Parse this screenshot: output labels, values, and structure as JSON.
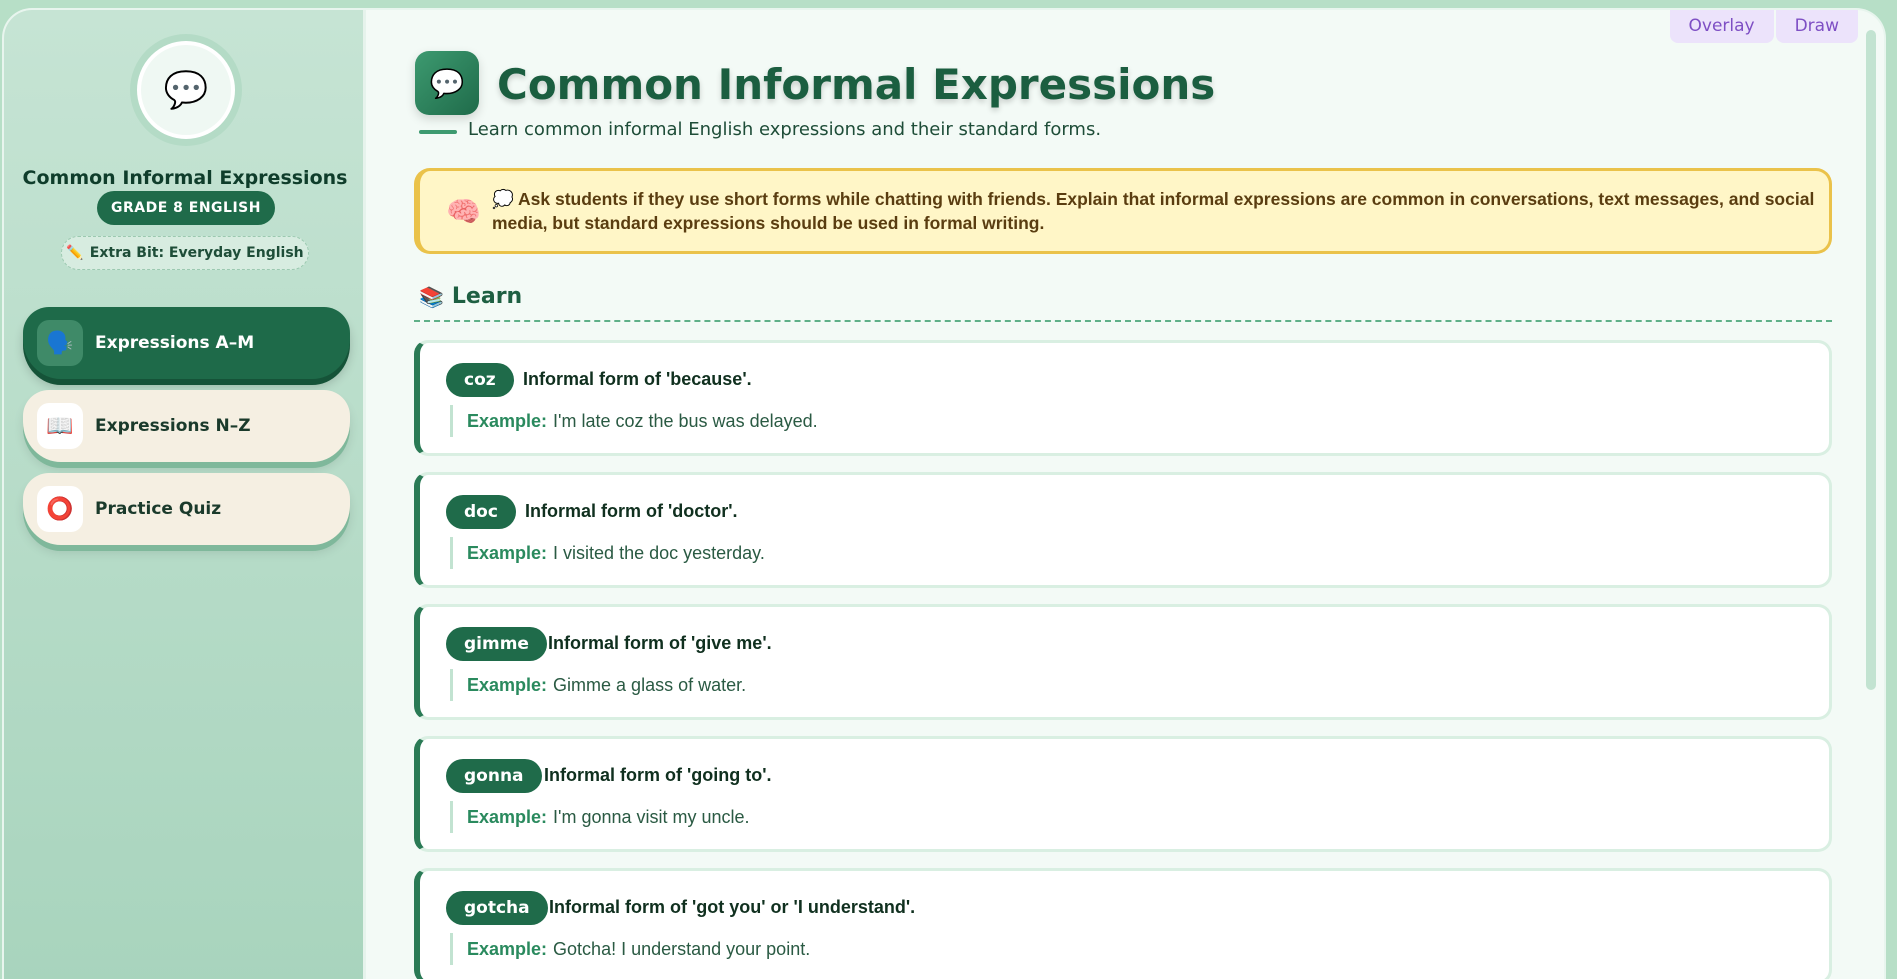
{
  "top_buttons": {
    "overlay": "Overlay",
    "draw": "Draw"
  },
  "sidebar": {
    "avatar_icon": "speech-bubble-icon",
    "title": "Common Informal Expressions",
    "grade_badge": "GRADE 8 ENGLISH",
    "extra_bit": "Extra Bit: Everyday English",
    "nav": [
      {
        "label": "Expressions A–M",
        "icon": "🗣️",
        "active": true
      },
      {
        "label": "Expressions N–Z",
        "icon": "📖",
        "active": false
      },
      {
        "label": "Practice Quiz",
        "icon": "⭕",
        "active": false
      }
    ]
  },
  "main": {
    "title": "Common Informal Expressions",
    "subtitle": "Learn common informal English expressions and their standard forms.",
    "tip": "💭 Ask students if they use short forms while chatting with friends. Explain that informal expressions are common in conversations, text messages, and social media, but standard expressions should be used in formal writing.",
    "section_title": "Learn",
    "example_label": "Example:",
    "cards": [
      {
        "term": "coz",
        "meaning": "Informal form of 'because'.",
        "example": "I'm late coz the bus was delayed."
      },
      {
        "term": "doc",
        "meaning": "Informal form of 'doctor'.",
        "example": "I visited the doc yesterday."
      },
      {
        "term": "gimme",
        "meaning": "Informal form of 'give me'.",
        "example": "Gimme a glass of water."
      },
      {
        "term": "gonna",
        "meaning": "Informal form of 'going to'.",
        "example": "I'm gonna visit my uncle."
      },
      {
        "term": "gotcha",
        "meaning": "Informal form of 'got you' or 'I understand'.",
        "example": "Gotcha! I understand your point."
      }
    ]
  },
  "colors": {
    "accent": "#1f6b4a",
    "tip_border": "#eac24a",
    "tip_bg": "#fff6c7"
  }
}
